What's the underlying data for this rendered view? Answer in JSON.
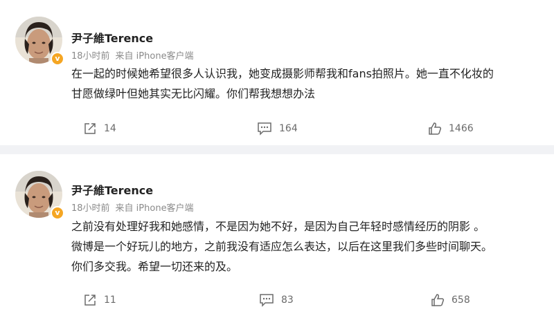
{
  "posts": [
    {
      "username": "尹子維Terence",
      "time": "18小时前",
      "source": "来自 iPhone客户端",
      "content_lines": [
        "在一起的时候她希望很多人认识我，她变成摄影师帮我和fans拍照片。她一直不化妆的",
        "甘愿做绿叶但她其实无比闪耀。你们帮我想想办法"
      ],
      "reposts": "14",
      "comments": "164",
      "likes": "1466"
    },
    {
      "username": "尹子維Terence",
      "time": "18小时前",
      "source": "来自 iPhone客户端",
      "content_lines": [
        "之前没有处理好我和她感情，不是因为她不好，是因为自己年轻时感情经历的阴影 。",
        "微博是一个好玩儿的地方，之前我没有适应怎么表达，以后在这里我们多些时间聊天。",
        "你们多交我。希望一切还来的及。"
      ],
      "reposts": "11",
      "comments": "83",
      "likes": "658"
    }
  ],
  "colors": {
    "background": "#f1f2f5",
    "card": "#ffffff",
    "text": "#222222",
    "meta": "#8a8a8a",
    "verified": "#f5a623"
  },
  "icons": [
    "repost-icon",
    "comment-icon",
    "like-icon",
    "verified-badge-icon",
    "avatar"
  ]
}
